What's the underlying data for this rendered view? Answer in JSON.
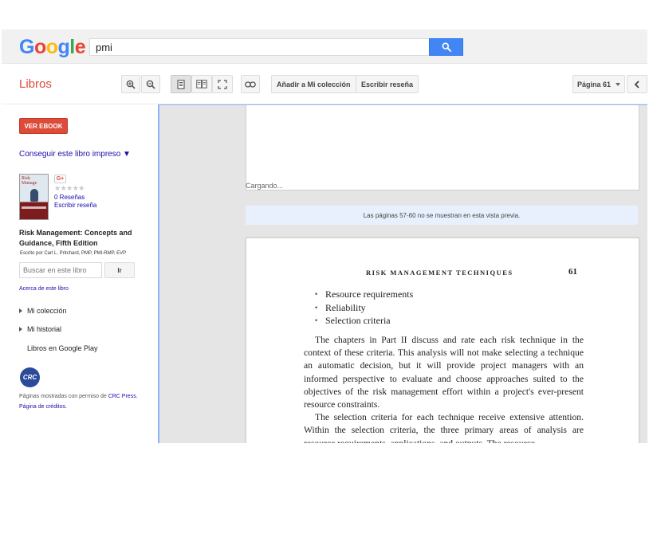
{
  "search": {
    "query": "pmi"
  },
  "logo": {
    "letters": [
      "G",
      "o",
      "o",
      "g",
      "l",
      "e"
    ],
    "colors": [
      "#4285f4",
      "#ea4335",
      "#fbbc05",
      "#4285f4",
      "#34a853",
      "#ea4335"
    ]
  },
  "toolbar": {
    "section_title": "Libros",
    "add_collection": "Añadir a Mi colección",
    "write_review": "Escribir reseña",
    "page_select": "Página 61"
  },
  "sidebar": {
    "ver_ebook": "VER EBOOK",
    "conseguir": "Conseguir este libro impreso ▼",
    "gplus": "G+",
    "stars": "★★★★★",
    "reviews_count": "0 Reseñas",
    "write_review": "Escribir reseña",
    "book_title": "Risk Management: Concepts and Guidance, Fifth Edition",
    "book_author": "Escrito por Carl L. Pritchard, PMP, PMI-RMP, EVP",
    "search_placeholder": "Buscar en este libro",
    "ir_button": "Ir",
    "about_link": "Acerca de este libro",
    "my_collection": "Mi colección",
    "my_history": "Mi historial",
    "google_play": "Libros en Google Play",
    "publisher_logo": "CRC",
    "permission_text": "Páginas mostradas con permiso de",
    "publisher_link": "CRC Press",
    "credits_link": "Página de créditos."
  },
  "viewer": {
    "loading": "Cargando...",
    "omitted_notice": "Las páginas 57-60 no se muestran en esta vista previa.",
    "running_head": "RISK MANAGEMENT TECHNIQUES",
    "page_number": "61",
    "bullets": [
      "Resource requirements",
      "Reliability",
      "Selection criteria"
    ],
    "paragraph_1": "The chapters in Part II discuss and rate each risk technique in the context of these criteria. This analysis will not make selecting a technique an automatic decision, but it will provide project managers with an informed perspective to evaluate and choose approaches suited to the objectives of the risk management effort within a project's ever-present resource constraints.",
    "paragraph_2": "The selection criteria for each technique receive extensive attention. Within the selection criteria, the three primary areas of analysis are resource requirements, applications, and outputs. The resource"
  }
}
